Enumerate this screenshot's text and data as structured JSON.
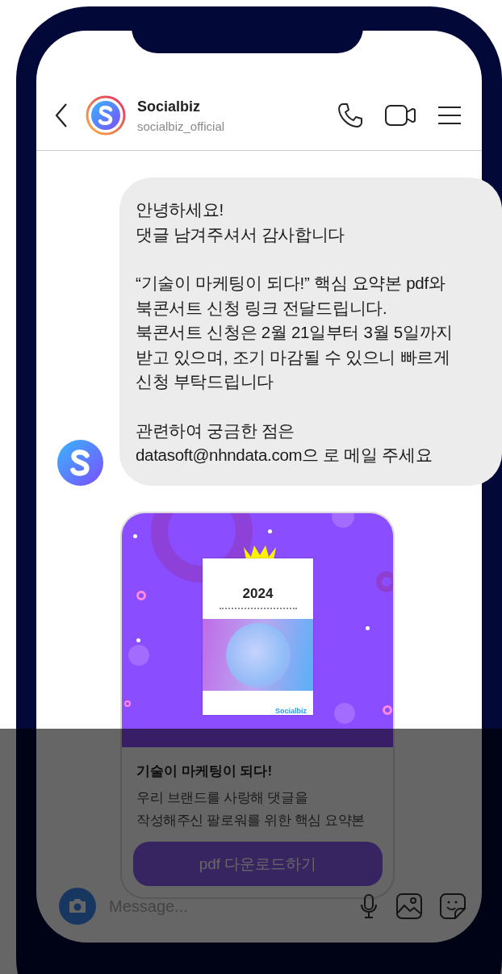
{
  "header": {
    "name": "Socialbiz",
    "handle": "socialbiz_official"
  },
  "message": {
    "paragraphs": [
      "안녕하세요!\n댓글 남겨주셔서 감사합니다",
      "“기술이 마케팅이 되다!” 핵심 요약본 pdf와\n북콘서트 신청 링크 전달드립니다.\n북콘서트 신청은 2월 21일부터 3월 5일까지\n받고 있으며, 조기 마감될 수 있으니 빠르게\n신청 부탁드립니다",
      "관련하여 궁금한 점은\ndatasoft@nhndata.com으 로 메일 주세요"
    ]
  },
  "card": {
    "cover_year": "2024",
    "cover_brand": "Socialbiz",
    "title": "기술이 마케팅이 되다!",
    "description": "우리 브랜드를 사랑해 댓글을\n작성해주신 팔로워를 위한 핵심 요약본",
    "button": "pdf 다운로드하기"
  },
  "composer": {
    "placeholder": "Message..."
  }
}
